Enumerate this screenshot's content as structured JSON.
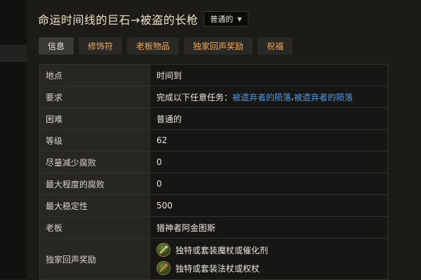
{
  "header": {
    "title": "命运时间线的巨石→被盗的长枪",
    "difficulty": "普通的"
  },
  "tabs": [
    {
      "label": "信息",
      "active": true
    },
    {
      "label": "修饰符",
      "active": false
    },
    {
      "label": "老板物品",
      "active": false
    },
    {
      "label": "独家回声奖励",
      "active": false
    },
    {
      "label": "祝福",
      "active": false
    }
  ],
  "info": {
    "location": {
      "label": "地点",
      "value": "时间到"
    },
    "requirement": {
      "label": "要求",
      "prefix": "完成以下任意任务：",
      "link1": "被遗弃者的陨落",
      "separator": ",",
      "link2": "被遗弃者的陨落"
    },
    "difficulty": {
      "label": "困难",
      "value": "普通的"
    },
    "level": {
      "label": "等级",
      "value": "62"
    },
    "min_corruption": {
      "label": "尽量减少腐败",
      "value": "0"
    },
    "max_corruption": {
      "label": "最大程度的腐败",
      "value": "0"
    },
    "max_stability": {
      "label": "最大稳定性",
      "value": "500"
    },
    "boss": {
      "label": "老板",
      "value": "猎神者阿金图斯"
    },
    "rewards": {
      "label": "独家回声奖励",
      "items": [
        {
          "text": "独特或套装魔杖或催化剂",
          "icon": "wand-icon"
        },
        {
          "text": "独特或套装法杖或权杖",
          "icon": "staff-icon"
        }
      ]
    }
  },
  "colors": {
    "tab_text": "#f0a95c",
    "link": "#4e9be0",
    "title": "#f0e2c6"
  }
}
